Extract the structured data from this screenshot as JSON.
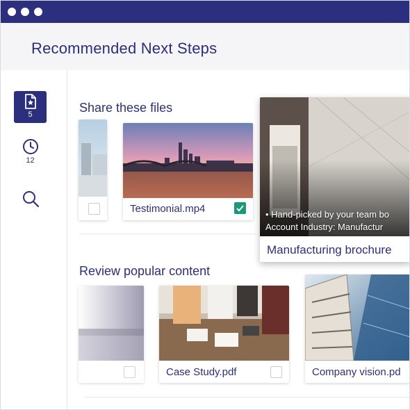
{
  "window": {
    "titlebar_color": "#2c2e7e",
    "accent_color": "#2c2e7e",
    "check_color": "#1a9a74"
  },
  "header": {
    "title": "Recommended Next Steps"
  },
  "sidebar": {
    "items": [
      {
        "icon": "starred-file-icon",
        "count": "5",
        "active": true
      },
      {
        "icon": "clock-icon",
        "count": "12",
        "active": false
      },
      {
        "icon": "search-icon",
        "count": "",
        "active": false
      }
    ]
  },
  "sections": [
    {
      "title": "Share these files",
      "cards": [
        {
          "label": "",
          "checked": false
        },
        {
          "label": "Testimonial.mp4",
          "checked": true
        },
        {
          "label": "Manufacturing brochure",
          "checked": false,
          "tags": [
            "• Hand-picked by your team bo",
            "Account Industry: Manufactur"
          ]
        }
      ]
    },
    {
      "title": "Review popular content",
      "cards": [
        {
          "label": "",
          "checked": false
        },
        {
          "label": "Case Study.pdf",
          "checked": false
        },
        {
          "label": "Company vision.pd",
          "checked": false
        }
      ]
    }
  ]
}
